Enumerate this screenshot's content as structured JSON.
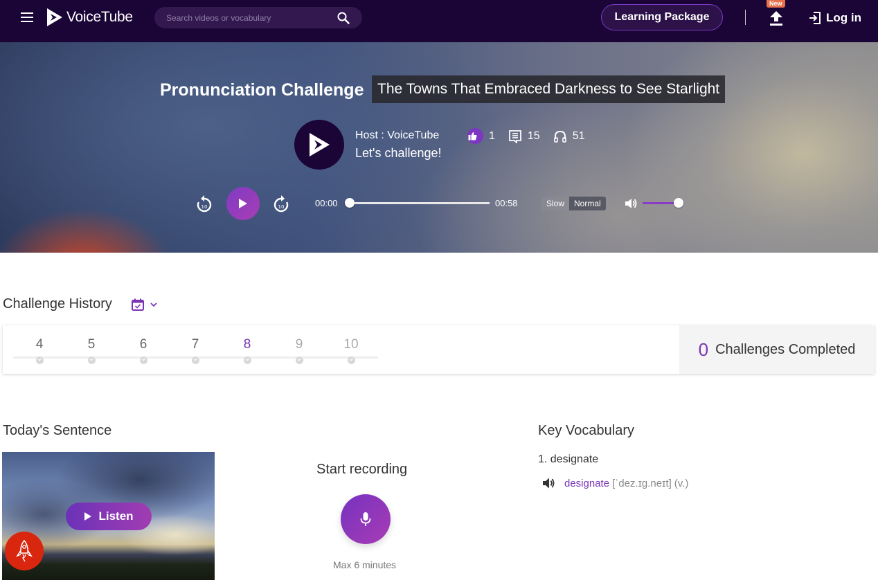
{
  "nav": {
    "brand": "VoiceTube",
    "search_placeholder": "Search videos or vocabulary",
    "learning_package": "Learning Package",
    "new_badge": "New",
    "login": "Log in",
    "icons": [
      "menu-icon",
      "logo-icon",
      "search-icon",
      "upload-icon",
      "login-icon"
    ]
  },
  "hero": {
    "title": "Pronunciation Challenge",
    "subtitle": "The Towns That Embraced Darkness to See Starlight",
    "host": "Host : VoiceTube",
    "message": "Let's challenge!",
    "likes": "1",
    "comments": "15",
    "listens": "51"
  },
  "player": {
    "current_time": "00:00",
    "total_time": "00:58",
    "progress": 0,
    "speed_options": [
      "Slow",
      "Normal"
    ],
    "speed_selected": "Normal",
    "volume": 1.0,
    "accent": "#8a3cc6"
  },
  "history": {
    "title": "Challenge History",
    "days": [
      {
        "label": "4",
        "state": "past"
      },
      {
        "label": "5",
        "state": "past"
      },
      {
        "label": "6",
        "state": "past"
      },
      {
        "label": "7",
        "state": "past"
      },
      {
        "label": "8",
        "state": "today"
      },
      {
        "label": "9",
        "state": "future"
      },
      {
        "label": "10",
        "state": "future"
      }
    ],
    "completed_count": "0",
    "completed_label": "Challenges Completed"
  },
  "today": {
    "title": "Today's Sentence",
    "listen": "Listen",
    "record_title": "Start recording",
    "record_max": "Max 6 minutes"
  },
  "vocab": {
    "title": "Key Vocabulary",
    "items": [
      {
        "heading": "1. designate",
        "word": "designate",
        "ipa": "[ˈdez.ɪɡ.neɪt]",
        "pos": "(v.)"
      }
    ]
  },
  "colors": {
    "nav_bg": "#1a0536",
    "brand_purple": "#7a35b5",
    "badge": "#e8704a",
    "rocket": "#d9260e"
  }
}
